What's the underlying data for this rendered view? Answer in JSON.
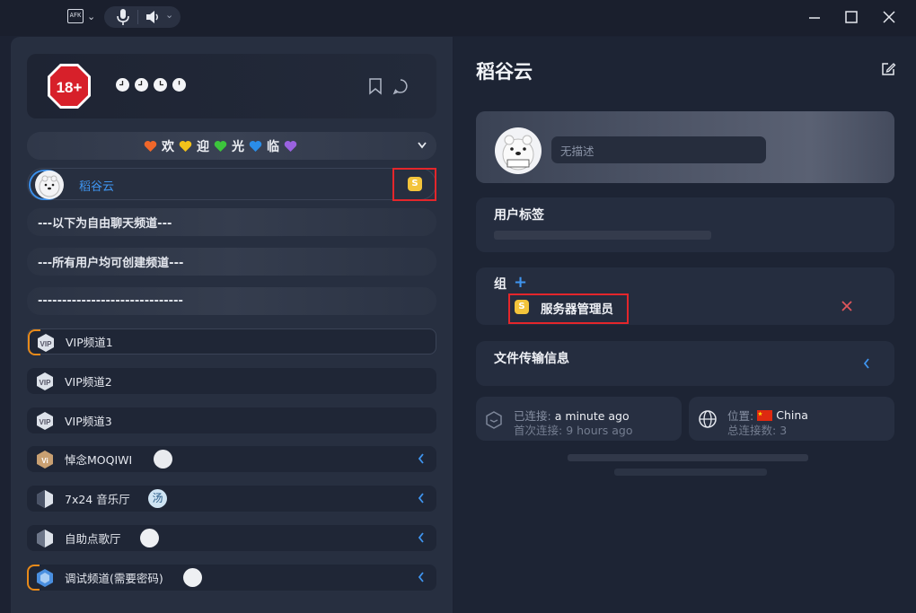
{
  "titlebar": {
    "afk_label": "AFK",
    "icons": [
      "afk-icon",
      "chevron-down-icon",
      "microphone-icon",
      "speaker-icon",
      "chevron-down-icon",
      "minimize-icon",
      "maximize-icon",
      "close-icon"
    ]
  },
  "banner": {
    "logo_text": "18+",
    "clock_icons": [
      "clock-icon",
      "clock-icon",
      "clock-icon",
      "clock-icon"
    ]
  },
  "welcome": {
    "hearts": [
      "#f0672a",
      "#f2c21b",
      "#3cc43c",
      "#2a8de8",
      "#9a62e0"
    ],
    "words": [
      "欢",
      "迎",
      "光",
      "临"
    ]
  },
  "user": {
    "name": "稻谷云",
    "badge": "S"
  },
  "separators": [
    "---以下为自由聊天频道---",
    "---所有用户均可创建频道---",
    "------------------------------"
  ],
  "channels": [
    {
      "name": "VIP频道1"
    },
    {
      "name": "VIP频道2"
    },
    {
      "name": "VIP频道3"
    },
    {
      "name": "悼念MOQIWI"
    },
    {
      "name": "7x24 音乐厅",
      "avatar_text": "汤"
    },
    {
      "name": "自助点歌厅"
    },
    {
      "name": "调试频道(需要密码)"
    }
  ],
  "right": {
    "title": "稻谷云",
    "description_placeholder": "无描述",
    "user_tags_title": "用户标签",
    "groups_title": "组",
    "group_name": "服务器管理员",
    "group_badge": "S",
    "file_transfer_title": "文件传输信息",
    "connected_label": "已连接:",
    "connected_value": "a minute ago",
    "first_connect_label": "首次连接:",
    "first_connect_value": "9 hours ago",
    "location_label": "位置:",
    "location_value": "China",
    "total_connections_label": "总连接数:",
    "total_connections_value": "3"
  },
  "colors": {
    "accent_blue": "#3f95f0",
    "badge_yellow": "#f3c43b",
    "highlight_red": "#e4262b",
    "remove_red": "#e0565b"
  }
}
